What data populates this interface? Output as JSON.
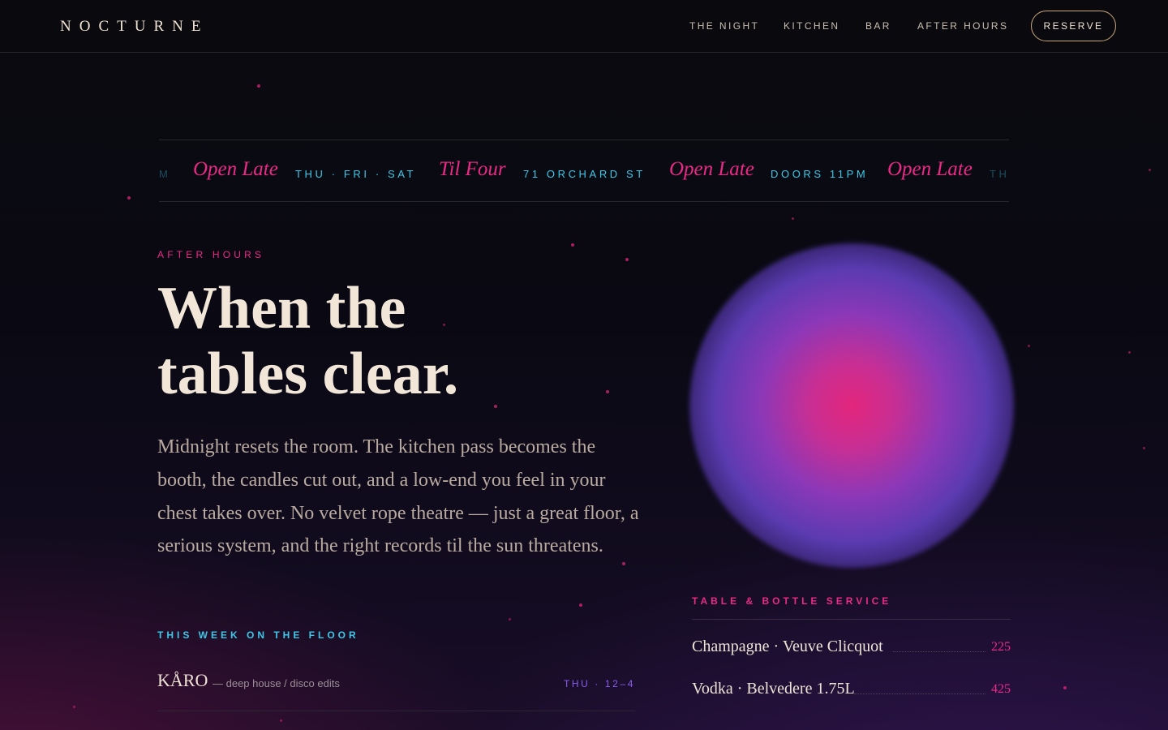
{
  "brand": {
    "logo": "NOCTURNE"
  },
  "nav": {
    "items": [
      "THE NIGHT",
      "KITCHEN",
      "BAR",
      "AFTER HOURS"
    ],
    "reserve_label": "RESERVE"
  },
  "marquee": {
    "items": [
      {
        "text": "M",
        "style": "fade"
      },
      {
        "text": "Open Late",
        "style": "script"
      },
      {
        "text": "THU · FRI · SAT",
        "style": "caps"
      },
      {
        "text": "Til Four",
        "style": "script"
      },
      {
        "text": "71 ORCHARD ST",
        "style": "caps"
      },
      {
        "text": "Open Late",
        "style": "script"
      },
      {
        "text": "DOORS 11PM",
        "style": "caps"
      },
      {
        "text": "Open Late",
        "style": "script"
      },
      {
        "text": "TH",
        "style": "fade"
      }
    ]
  },
  "hero": {
    "eyebrow": "AFTER HOURS",
    "headline_line1": "When the",
    "headline_line2": "tables clear.",
    "lede": "Midnight resets the room. The kitchen pass becomes the booth, the candles cut out, and a low-end you feel in your chest takes over. No velvet rope theatre — just a great floor, a serious system, and the right records til the sun threatens."
  },
  "week": {
    "title": "THIS WEEK ON THE FLOOR",
    "acts": [
      {
        "name": "KÅRO",
        "genre": "— deep house / disco edits",
        "time": "THU · 12–4"
      }
    ]
  },
  "bottle_service": {
    "title": "TABLE & BOTTLE SERVICE",
    "items": [
      {
        "name": "Champagne · Veuve Clicquot",
        "price": "225"
      },
      {
        "name": "Vodka · Belvedere 1.75L",
        "price": "425"
      }
    ]
  },
  "colors": {
    "accent_pink": "#ea2a86",
    "accent_cyan": "#3ec8e8",
    "accent_violet": "#8b5cf0",
    "cream": "#efe3d6",
    "background": "#0a0910"
  }
}
